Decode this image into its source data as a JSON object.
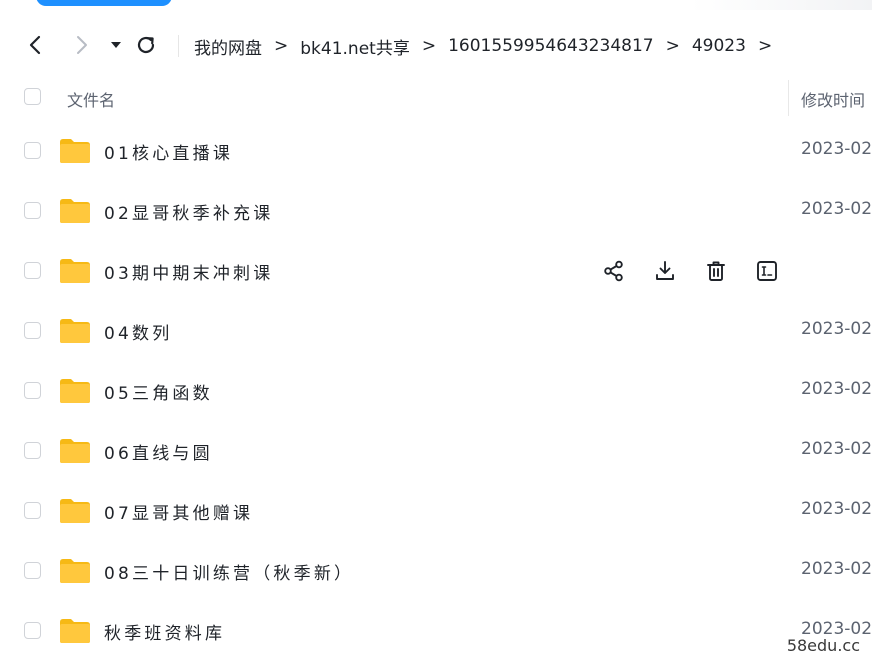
{
  "breadcrumb": [
    "我的网盘",
    "bk41.net共享",
    "1601559954643234817",
    "49023"
  ],
  "breadcrumb_separator": ">",
  "columns": {
    "name": "文件名",
    "modified": "修改时间"
  },
  "rows": [
    {
      "name": "01核心直播课",
      "date": "2023-02"
    },
    {
      "name": "02显哥秋季补充课",
      "date": "2023-02"
    },
    {
      "name": "03期中期末冲刺课",
      "date": ""
    },
    {
      "name": "04数列",
      "date": "2023-02"
    },
    {
      "name": "05三角函数",
      "date": "2023-02"
    },
    {
      "name": "06直线与圆",
      "date": "2023-02"
    },
    {
      "name": "07显哥其他赠课",
      "date": "2023-02"
    },
    {
      "name": "08三十日训练营（秋季新）",
      "date": "2023-02"
    },
    {
      "name": "秋季班资料库",
      "date": "2023-02"
    }
  ],
  "hover_actions": [
    "share-icon",
    "download-icon",
    "delete-icon",
    "rename-icon"
  ],
  "watermark": "58edu.cc",
  "colors": {
    "accent": "#1e90ff",
    "folder": "#ffc83d",
    "text": "#1f2329",
    "muted": "#5c6370"
  }
}
